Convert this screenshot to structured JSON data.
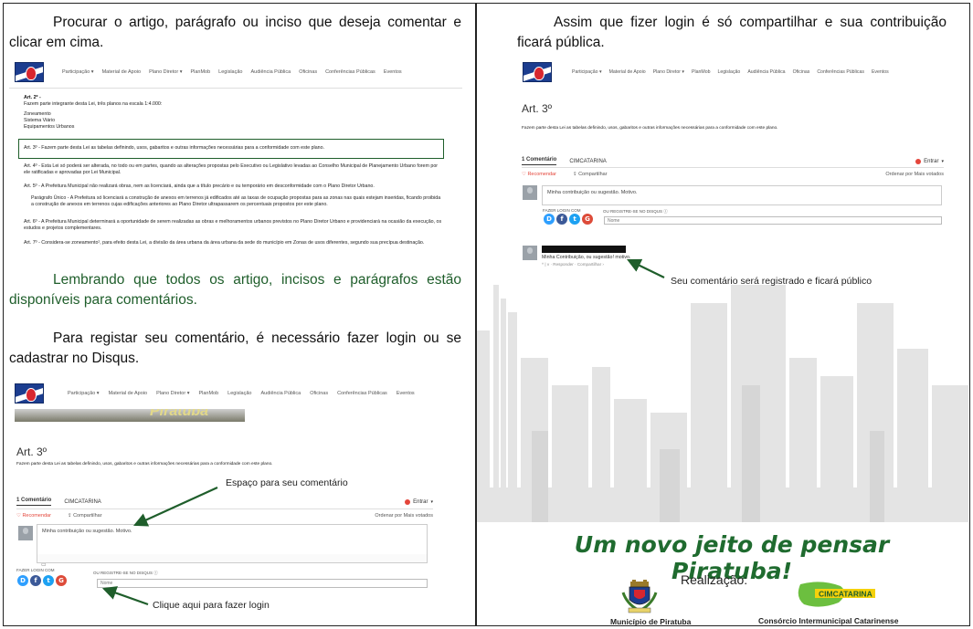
{
  "left": {
    "instruction_1": "Procurar o artigo, parágrafo ou inciso que deseja comentar e clicar em cima.",
    "instruction_2": "Lembrando que todos os artigo, incisos e parágrafos estão disponíveis para comentários.",
    "instruction_3": "Para registar seu comentário, é necessário fazer login ou se cadastrar no Disqus."
  },
  "nav": {
    "items": [
      "Participação ▾",
      "Material de Apoio",
      "Plano Diretor ▾",
      "PlanMob",
      "Legislação",
      "Audiência Pública",
      "Oficinas",
      "Conferências Públicas",
      "Eventos"
    ]
  },
  "screenshot_1": {
    "art2_title": "Art. 2º -",
    "art2_text": "Fazem parte integrante desta Lei, três planos na escala 1:4.000:",
    "art2_items": [
      "Zoneamento",
      "Sistema Viário",
      "Equipamentos Urbanos"
    ],
    "art3": "Art. 3º - Fazem parte desta Lei as tabelas definindo, usos, gabaritos e outras informações necessárias para a conformidade com este plano.",
    "art4": "Art. 4º - Esta Lei só poderá ser alterada, no todo ou em partes, quando as alterações propostas pelo Executivo ou Legislativo levadas ao Conselho Municipal de Planejamento Urbano forem por ele ratificadas e aprovadas por Lei Municipal.",
    "art5": "Art. 5º - A Prefeitura Municipal não realizará obras, nem as licenciará, ainda que a título precário e ou temporário em desconformidade com o Plano Diretor Urbano.",
    "paragrafo": "Parágrafo Único - A Prefeitura só licenciará a construção de anexos em terrenos já edificados até as taxas de ocupação propostas para as zonas nas quais estejam inseridas, ficando proibida a construção de anexos em terrenos cujas edificações anteriores ao Plano Diretor ultrapassarem os percentuais propostos por este plano.",
    "art6": "Art. 6º - A Prefeitura Municipal determinará a oportunidade de serem realizadas as obras e melhoramentos urbanos previstos no Plano Diretor Urbano e providenciará na ocasião da execução, os estudos e projetos complementares.",
    "art7": "Art. 7º - Considera-se zoneamento¹, para efeito desta Lei, a divisão da área urbana da área urbana da sede do município em Zonas de usos diferentes, segundo sua precípua destinação."
  },
  "disqus": {
    "art_title": "Art. 3º",
    "art_text": "Fazem parte desta Lei as tabelas definindo, usos, gabaritos e outras informações necessárias para a conformidade com este plano.",
    "tab_comments": "1 Comentário",
    "tab_forum": "CIMCATARINA",
    "login": "Entrar",
    "recommend": "♡ Recomendar",
    "share": "⇪ Compartilhar",
    "order": "Ordenar por Mais votados",
    "comment_text": "Minha contribuição ou sugestão. Motivo.",
    "login_with": "FAZER LOGIN COM",
    "or_register": "OU REGISTRE-SE NO DISQUS",
    "name_placeholder": "Nome",
    "banner_text": "Piratuba",
    "posted_comment": "Minha Contribuição, ou sugestão! motivo.",
    "posted_actions": "^ | v · Responder · Compartilhar ›"
  },
  "annotations": {
    "espaco": "Espaço para seu comentário",
    "clique": "Clique aqui para fazer login",
    "seu_comentario": "Seu comentário será registrado e ficará público"
  },
  "right": {
    "instruction": "Assim que fizer login é só compartilhar e sua contribuição ficará pública.",
    "slogan": "Um novo jeito de pensar Piratuba!",
    "realizacao": "Realização:",
    "logo_left": "Município de Piratuba",
    "logo_right": "Consórcio Intermunicipal Catarinense",
    "cim_logo": "CIMCATARINA"
  },
  "colors": {
    "green": "#1f5e2b",
    "slogan_green": "#1f6b2f",
    "skyline": "#e4e4e4"
  }
}
